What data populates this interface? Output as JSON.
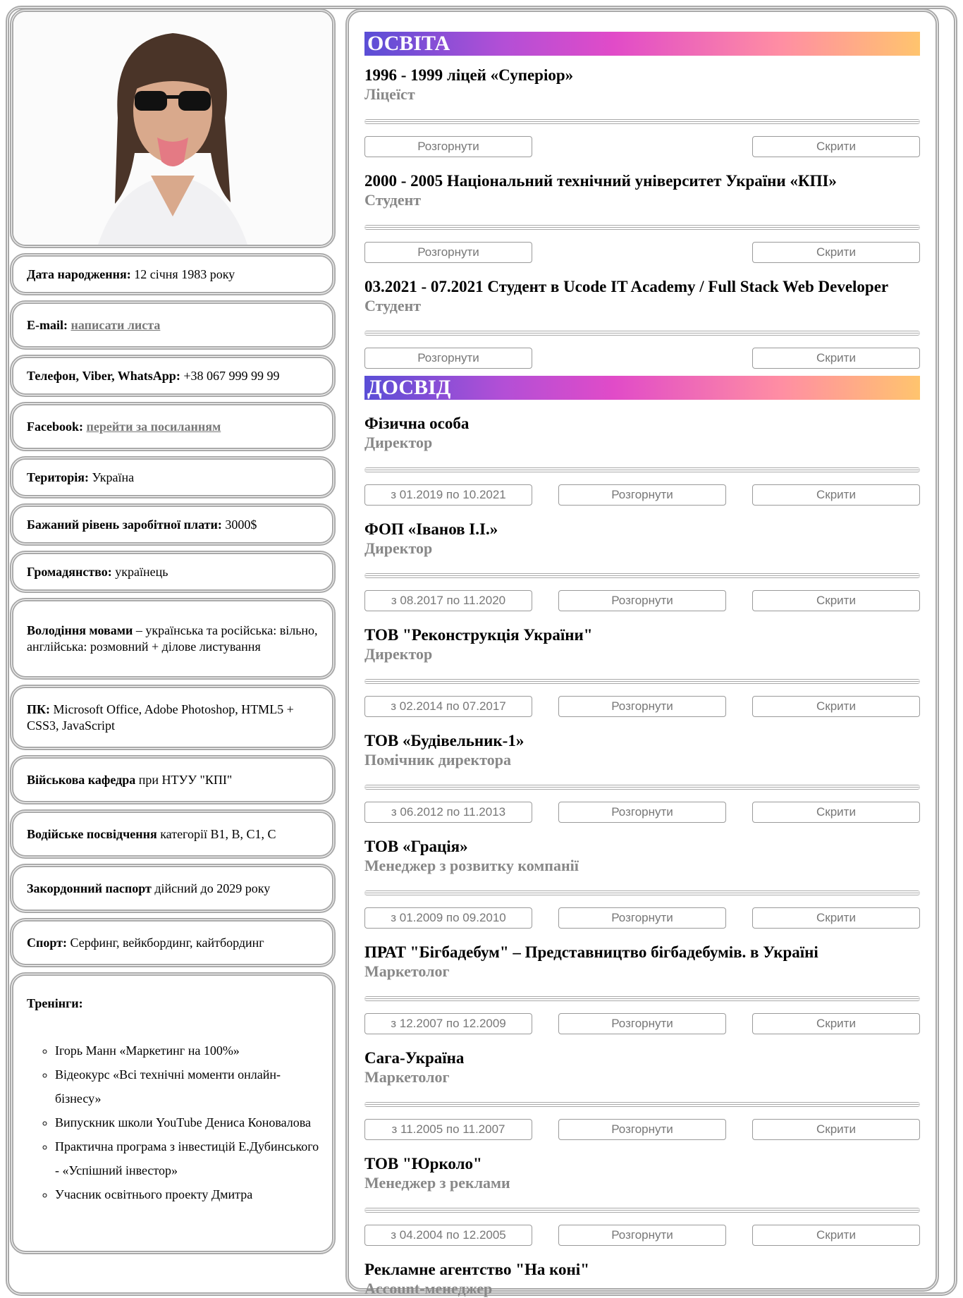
{
  "info_cards": [
    {
      "label": "Дата народження:",
      "value": " 12 січня 1983 року"
    },
    {
      "label": "E-mail:",
      "value": " ",
      "link": "написати листа"
    },
    {
      "label": "Телефон, Viber, WhatsApp:",
      "value": " +38 067 999 99 99"
    },
    {
      "label": "Facebook:",
      "value": " ",
      "link": "перейти за посиланням"
    },
    {
      "label": "Територія:",
      "value": " Україна"
    },
    {
      "label": "Бажаний рівень заробітної плати:",
      "value": " 3000$"
    },
    {
      "label": "Громадянство:",
      "value": " українець"
    },
    {
      "label": "Володіння мовами",
      "value": " – українська та російська: вільно, англійська: розмовний + ділове листування"
    },
    {
      "label": "ПК:",
      "value": " Microsoft Office, Adobe Photoshop, HTML5 + CSS3, JavaScript"
    },
    {
      "label": "Військова кафедра",
      "value": " при НТУУ \"КПІ\""
    },
    {
      "label": "Водійське посвідчення",
      "value": " категорії В1, В, С1, С"
    },
    {
      "label": "Закордонний паспорт",
      "value": " дійсний до 2029 року"
    },
    {
      "label": "Спорт:",
      "value": " Серфинг, вейкбординг, кайтбординг"
    }
  ],
  "trainings": {
    "label": "Тренінги:",
    "items": [
      "Ігорь Манн «Маркетинг на 100%»",
      "Відеокурс «Всі технічні моменти онлайн-бізнесу»",
      "Випускник школи YouTube Дениса Коновалова",
      "Практична програма з інвестицій Е.Дубинського - «Успішний інвестор»",
      "Учасник освітнього проекту Дмитра"
    ]
  },
  "education": {
    "title": "ОСВІТА",
    "entries": [
      {
        "heading": "1996 - 1999 ліцей «Суперіор»",
        "role": "Ліцеїст"
      },
      {
        "heading": "2000 - 2005 Національний технічний університет України «КПІ»",
        "role": "Студент"
      },
      {
        "heading": "03.2021 - 07.2021 Студент в Ucode IT Academy / Full Stack Web Developer",
        "role": "Студент"
      }
    ]
  },
  "experience": {
    "title": "ДОСВІД",
    "entries": [
      {
        "heading": "Фізична особа",
        "role": "Директор",
        "period": "з 01.2019 по 10.2021"
      },
      {
        "heading": "ФОП «Іванов І.І.»",
        "role": "Директор",
        "period": "з 08.2017 по 11.2020"
      },
      {
        "heading": "ТОВ \"Реконструкція України\"",
        "role": "Директор",
        "period": "з 02.2014 по 07.2017"
      },
      {
        "heading": "ТОВ «Будівельник-1»",
        "role": "Помічник директора",
        "period": "з 06.2012 по 11.2013"
      },
      {
        "heading": "ТОВ «Грація»",
        "role": "Менеджер з розвитку компанії",
        "period": "з 01.2009 по 09.2010"
      },
      {
        "heading": "ПРАТ \"Бігбадебум\" – Представництво бігбадебумів. в Україні",
        "role": "Маркетолог",
        "period": "з 12.2007 по 12.2009"
      },
      {
        "heading": "Сага-Україна",
        "role": "Маркетолог",
        "period": "з 11.2005 по 11.2007"
      },
      {
        "heading": "ТОВ \"Юрколо\"",
        "role": "Менеджер з реклами",
        "period": "з 04.2004 по 12.2005"
      },
      {
        "heading": "Рекламне агентство \"На коні\"",
        "role": "Account-менеджер"
      }
    ]
  },
  "buttons": {
    "expand": "Розгорнути",
    "hide": "Скрити"
  }
}
